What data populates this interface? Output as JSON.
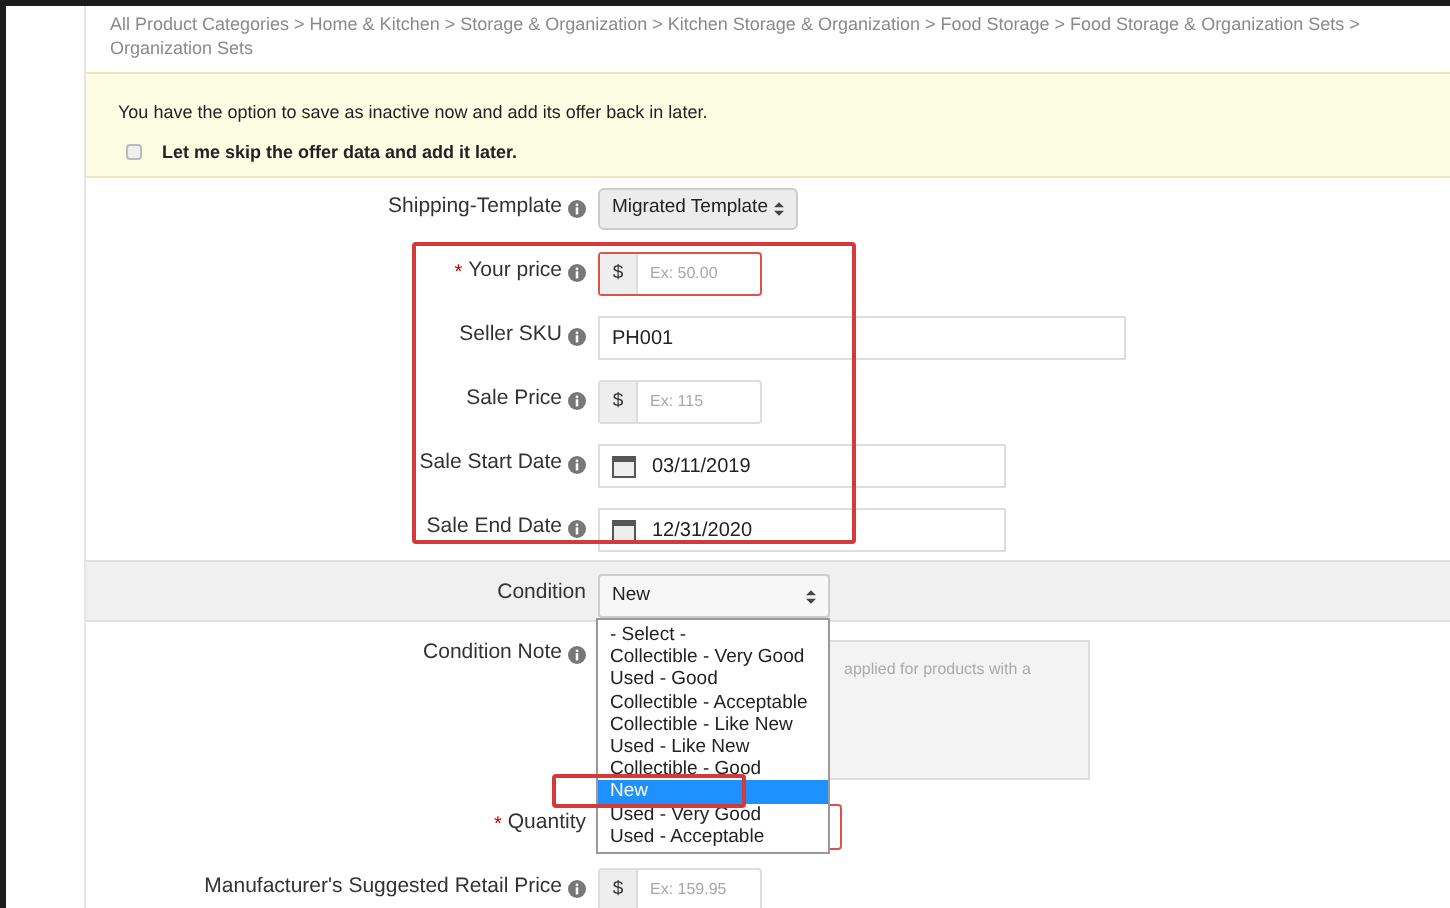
{
  "breadcrumb": [
    "All Product Categories > Home & Kitchen > Storage & Organization > Kitchen Storage & Organization > Food Storage > Food Storage & Organization Sets >",
    "Organization Sets"
  ],
  "notice": {
    "text": "You have the option to save as inactive now and add its offer back in later.",
    "checkbox": {
      "label": "Let me skip the offer data and add it later.",
      "checked": false
    }
  },
  "fields": [
    {
      "kind": "select",
      "label": "Shipping-Template",
      "info": true,
      "value": "Migrated Template"
    },
    {
      "kind": "money",
      "label": "Your price",
      "info": true,
      "required_mark": "*",
      "currency": "$",
      "placeholder": "Ex: 50.00"
    },
    {
      "kind": "text",
      "label": "Seller SKU",
      "info": true,
      "value": "PH001"
    },
    {
      "kind": "money",
      "label": "Sale Price",
      "info": true,
      "currency": "$",
      "placeholder": "Ex: 115"
    },
    {
      "kind": "date",
      "label": "Sale Start Date",
      "info": true,
      "value": "03/11/2019"
    },
    {
      "kind": "date",
      "label": "Sale End Date",
      "info": true,
      "value": "12/31/2020"
    },
    {
      "kind": "condition",
      "label": "Condition",
      "info": false,
      "value": "New"
    },
    {
      "kind": "textarea",
      "label": "Condition Note",
      "info": true,
      "placeholder": "applied for products with a"
    },
    {
      "kind": "quantity",
      "label": "Quantity",
      "info": false,
      "required_mark": "*"
    },
    {
      "kind": "money",
      "label": "Manufacturer's Suggested Retail Price",
      "info": true,
      "currency": "$",
      "placeholder": "Ex: 159.95"
    }
  ],
  "condition_options": [
    {
      "label": "- Select -",
      "selected": false
    },
    {
      "label": "Collectible - Very Good",
      "selected": false
    },
    {
      "label": "Used - Good",
      "selected": false
    },
    {
      "label": "Collectible - Acceptable",
      "selected": false
    },
    {
      "label": "Collectible - Like New",
      "selected": false
    },
    {
      "label": "Used - Like New",
      "selected": false
    },
    {
      "label": "Collectible - Good",
      "selected": false
    },
    {
      "label": "New",
      "selected": true
    },
    {
      "label": "Used - Very Good",
      "selected": false
    },
    {
      "label": "Used - Acceptable",
      "selected": false
    }
  ]
}
